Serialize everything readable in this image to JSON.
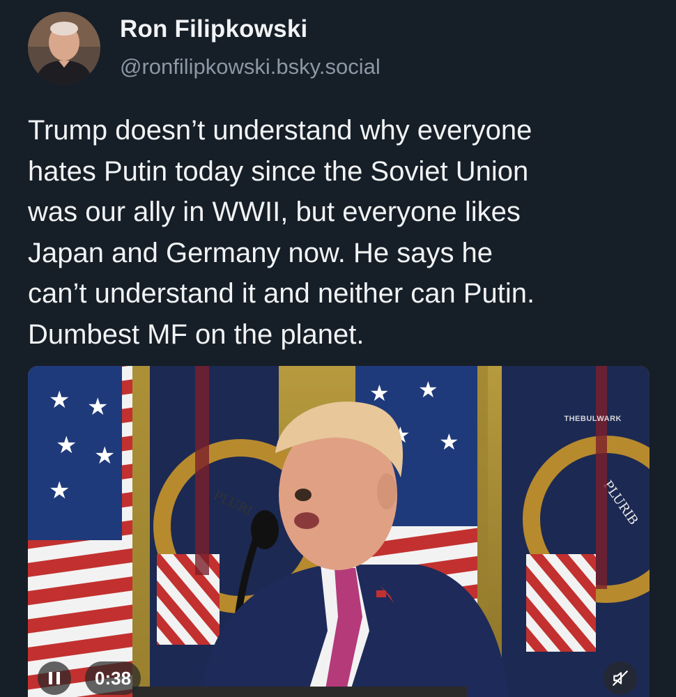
{
  "author": {
    "display_name": "Ron Filipkowski",
    "handle": "@ronfilipkowski.bsky.social",
    "avatar_icon": "user-avatar"
  },
  "post": {
    "text": "Trump doesn’t understand why everyone\nhates Putin today since the Soviet Union\nwas our ally in WWII, but everyone likes\nJapan and Germany now. He says he\ncan’t understand it and neither can Putin.\nDumbest MF on the planet."
  },
  "video": {
    "watermark": "THEBULWARK",
    "seal_text_left": "PLURI",
    "seal_text_right": "PLURIB",
    "time": "0:38",
    "pause_icon": "pause-icon",
    "mute_icon": "speaker-muted-icon"
  },
  "colors": {
    "background": "#161e27",
    "text_primary": "#f1f3f5",
    "text_secondary": "#8b98a5"
  }
}
